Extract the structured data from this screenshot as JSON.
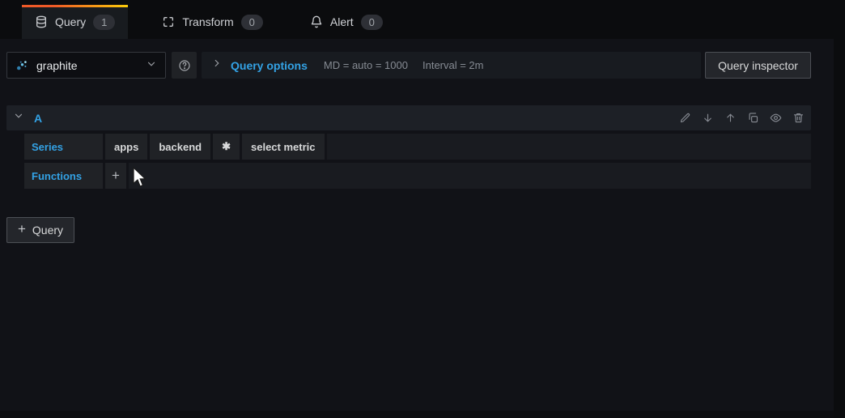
{
  "colors": {
    "accent_blue": "#33a2e5",
    "tab_gradient_start": "#f05a28",
    "tab_gradient_end": "#fbca0a",
    "panel_bg": "#181b1f",
    "canvas_bg": "#111217"
  },
  "tabs": {
    "query": {
      "label": "Query",
      "count": "1",
      "icon": "database-icon",
      "active": true
    },
    "transform": {
      "label": "Transform",
      "count": "0",
      "icon": "transform-icon",
      "active": false
    },
    "alert": {
      "label": "Alert",
      "count": "0",
      "icon": "bell-icon",
      "active": false
    }
  },
  "toolbar": {
    "datasource": {
      "value": "graphite",
      "icon": "graphite-datasource-icon"
    },
    "help": {
      "icon": "help-circle-icon"
    },
    "query_options": {
      "label": "Query options",
      "max_data_points": "MD = auto = 1000",
      "interval": "Interval = 2m"
    },
    "inspector_button_label": "Query inspector"
  },
  "query_editor": {
    "ref_id": "A",
    "row_action_icons": [
      "pencil-icon",
      "arrow-down-icon",
      "arrow-up-icon",
      "duplicate-icon",
      "eye-icon",
      "trash-icon"
    ],
    "series": {
      "label": "Series",
      "segments": [
        "apps",
        "backend",
        "✱",
        "select metric"
      ]
    },
    "functions": {
      "label": "Functions",
      "add_button": "+"
    }
  },
  "footer": {
    "add_query_label": "Query",
    "add_query_plus": "+"
  }
}
